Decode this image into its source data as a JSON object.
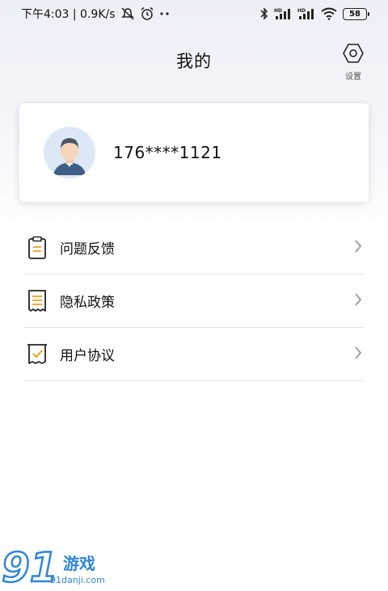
{
  "status_bar": {
    "time_speed": "下午4:03 | 0.9K/s",
    "battery": "58"
  },
  "header": {
    "title": "我的",
    "settings_label": "设置"
  },
  "profile": {
    "phone": "176****1121"
  },
  "menu": {
    "items": [
      {
        "label": "问题反馈",
        "icon": "clipboard-icon"
      },
      {
        "label": "隐私政策",
        "icon": "receipt-icon"
      },
      {
        "label": "用户协议",
        "icon": "checked-document-icon"
      }
    ]
  },
  "watermark": {
    "brand": "91",
    "text": "游戏",
    "url": "91danji.com"
  },
  "colors": {
    "accent": "#f0a020",
    "watermark": "#2f86d8"
  }
}
